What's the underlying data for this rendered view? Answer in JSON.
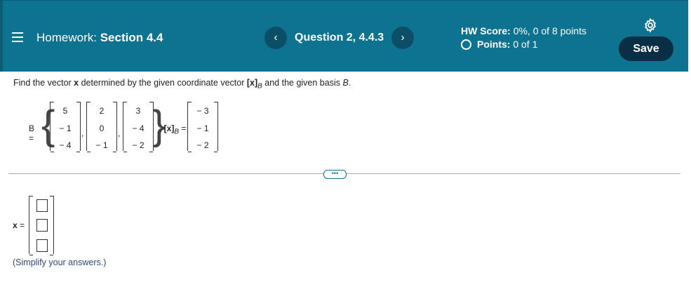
{
  "header": {
    "homework_prefix": "Homework:",
    "section": "Section 4.4",
    "question": "Question 2, 4.4.3",
    "prev_glyph": "‹",
    "next_glyph": "›",
    "hw_score_label": "HW Score:",
    "hw_score_value": "0%, 0 of 8 points",
    "points_label": "Points:",
    "points_value": "0 of 1",
    "save_label": "Save"
  },
  "prompt": {
    "text_before": "Find the vector ",
    "x_bold": "x",
    "text_mid": " determined by the given coordinate vector ",
    "coord_bold": "[x]",
    "coord_sub": "B",
    "text_after": " and the given basis ",
    "basis_italic": "B",
    "period": "."
  },
  "problem": {
    "b_label": "B =",
    "coord_label": "[x]",
    "coord_label_sub": "B",
    "equals": "=",
    "basis_vectors": [
      [
        "5",
        "− 1",
        "− 4"
      ],
      [
        "2",
        "0",
        "− 1"
      ],
      [
        "3",
        "− 4",
        "− 2"
      ]
    ],
    "coordinate_vector": [
      "− 3",
      "− 1",
      "− 2"
    ]
  },
  "answer": {
    "x_label": "x",
    "equals": " =",
    "simplify_note": "(Simplify your answers.)"
  },
  "more_glyph": "•••",
  "colors": {
    "header_bg": "#0e7391",
    "save_bg": "#0a2f44",
    "note_text": "#2b4a7a"
  }
}
